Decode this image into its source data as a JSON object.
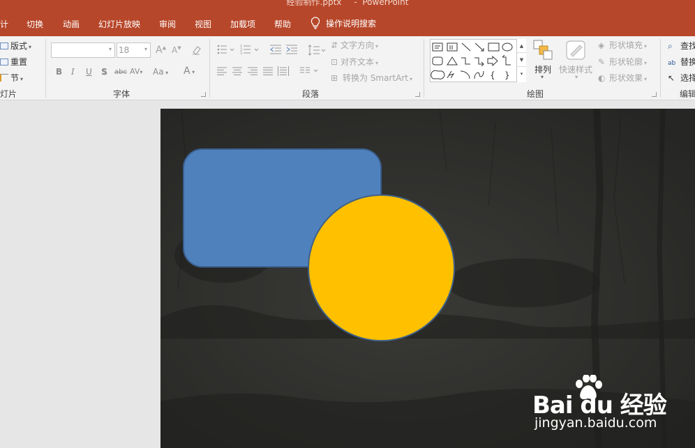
{
  "title": {
    "file": "经验制作.pptx",
    "sep": "-",
    "app": "PowerPoint"
  },
  "tabs": [
    "计",
    "切换",
    "动画",
    "幻灯片放映",
    "审阅",
    "视图",
    "加载项",
    "帮助"
  ],
  "tell_me": "操作说明搜索",
  "ribbon": {
    "slides": {
      "layout": "版式",
      "reset": "重置",
      "section": "节",
      "label": "灯片"
    },
    "font": {
      "name_value": "",
      "size_value": "18",
      "grow": "A",
      "shrink": "A",
      "bold": "B",
      "italic": "I",
      "underline": "U",
      "shadow": "S",
      "strike": "abc",
      "spacing": "AV",
      "case": "Aa",
      "color": "A",
      "label": "字体"
    },
    "paragraph": {
      "text_direction": "文字方向",
      "align_text": "对齐文本",
      "smartart": "转换为 SmartArt",
      "label": "段落"
    },
    "drawing": {
      "arrange": "排列",
      "quick_styles": "快速样式",
      "fill": "形状填充",
      "outline": "形状轮廓",
      "effects": "形状效果",
      "label": "绘图"
    },
    "editing": {
      "find": "查找",
      "replace": "替换",
      "select": "选择",
      "label": "编辑"
    }
  },
  "watermark": {
    "logo": "Bai du 经验",
    "url": "jingyan.baidu.com"
  },
  "colors": {
    "accent": "#b7472a",
    "rect_fill": "#4f81bd",
    "circle_fill": "#ffc000",
    "slide_bg": "#2f2f2d"
  }
}
